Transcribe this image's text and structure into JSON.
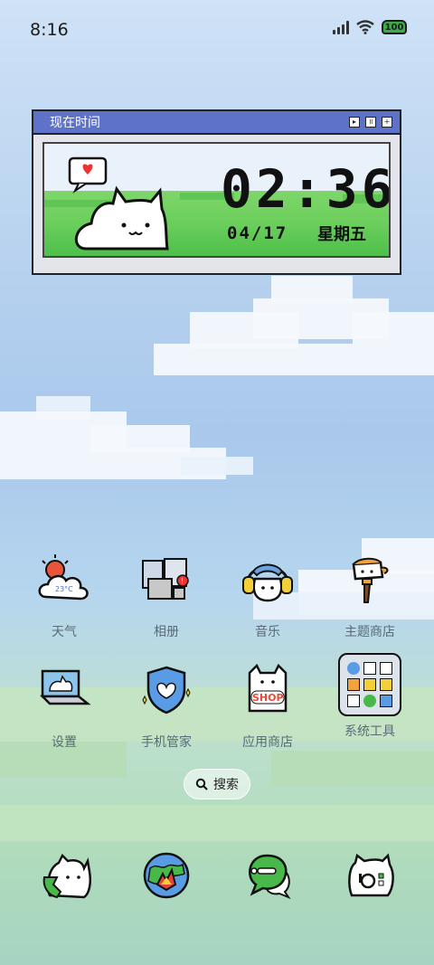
{
  "status": {
    "time": "8:16",
    "battery": "100"
  },
  "widget": {
    "title": "现在时间",
    "clock": "02:36",
    "date": "04/17",
    "weekday": "星期五"
  },
  "apps": [
    {
      "label": "天气",
      "icon": "weather-icon",
      "temp": "23°C"
    },
    {
      "label": "相册",
      "icon": "gallery-icon"
    },
    {
      "label": "音乐",
      "icon": "music-icon"
    },
    {
      "label": "主题商店",
      "icon": "theme-store-icon"
    },
    {
      "label": "设置",
      "icon": "settings-icon"
    },
    {
      "label": "手机管家",
      "icon": "phone-manager-icon"
    },
    {
      "label": "应用商店",
      "icon": "app-store-icon",
      "badge": "SHOP"
    },
    {
      "label": "系统工具",
      "icon": "system-tools-folder-icon"
    }
  ],
  "search": {
    "label": "搜索"
  },
  "dock": [
    {
      "icon": "phone-cat-icon"
    },
    {
      "icon": "browser-icon"
    },
    {
      "icon": "messages-icon"
    },
    {
      "icon": "camera-cat-icon"
    }
  ]
}
